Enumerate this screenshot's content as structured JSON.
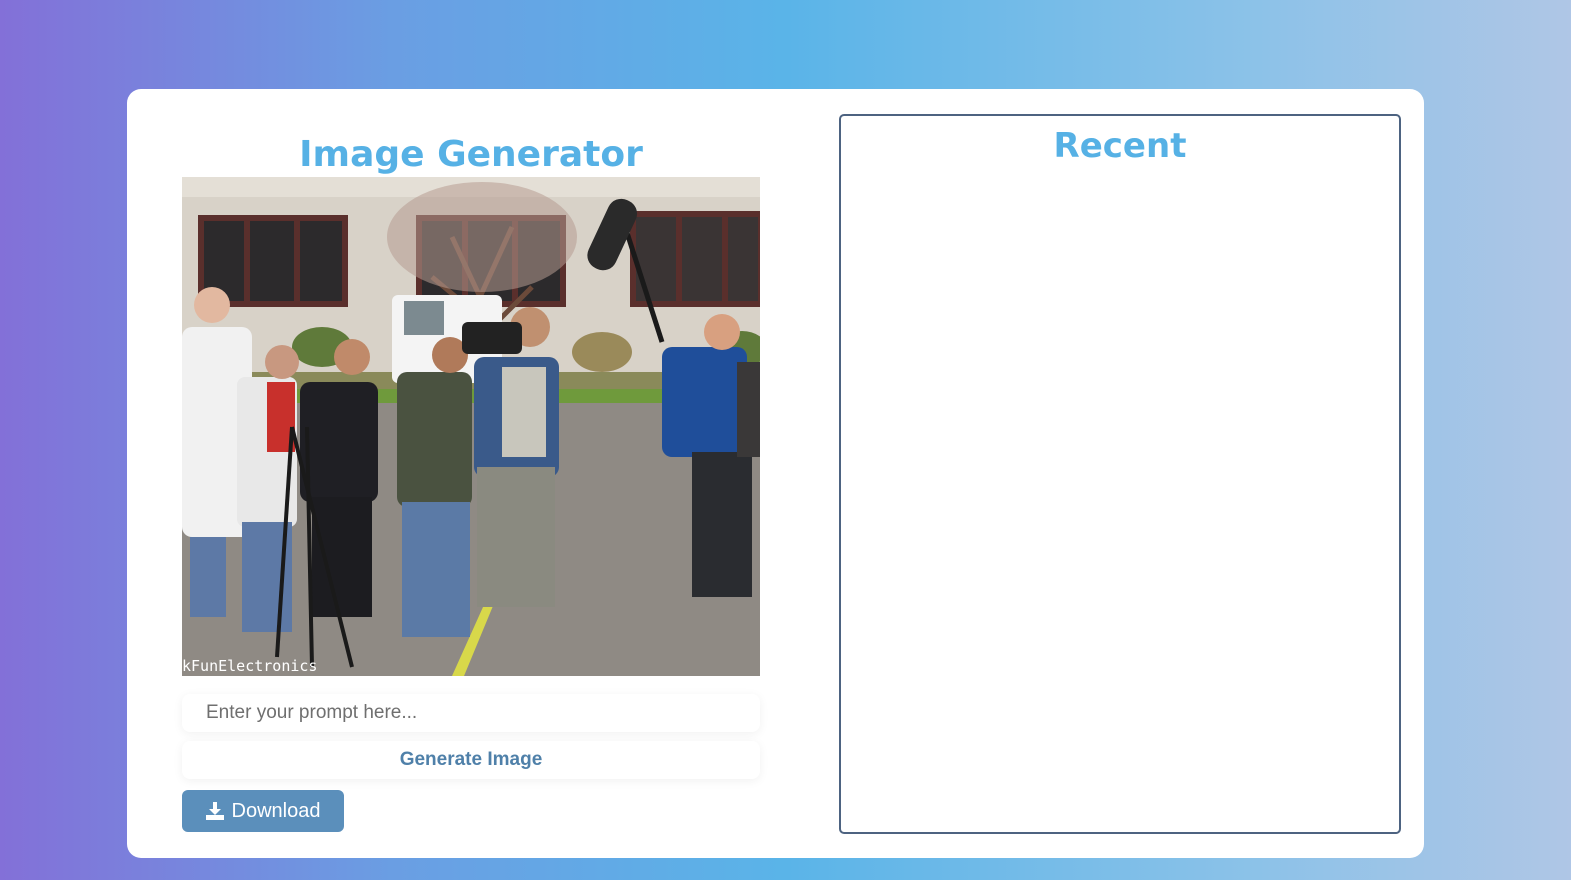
{
  "generator": {
    "title": "Image Generator",
    "image_watermark": "kFunElectronics",
    "prompt_placeholder": "Enter your prompt here...",
    "prompt_value": "",
    "generate_label": "Generate Image",
    "download_label": "Download",
    "download_icon": "download-icon"
  },
  "recent": {
    "title": "Recent",
    "items": []
  },
  "colors": {
    "accent": "#56b1e5",
    "button": "#5b8fbb",
    "panel_border": "#4d6381"
  }
}
